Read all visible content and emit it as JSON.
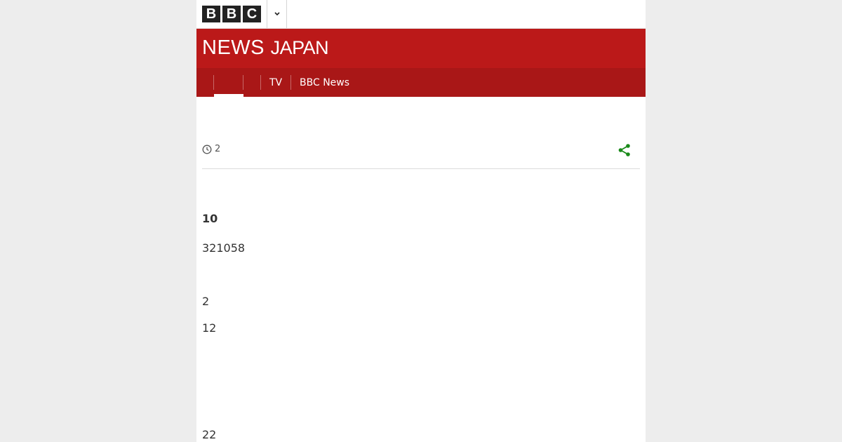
{
  "header": {
    "logo_letters": [
      "B",
      "B",
      "C"
    ],
    "menu_toggle_icon": "chevron-down-icon"
  },
  "brand": {
    "title_bold": "NEWS",
    "title_light": "JAPAN"
  },
  "nav": {
    "items": [
      {
        "label": ""
      },
      {
        "label": ""
      },
      {
        "label": "TV"
      },
      {
        "label": "BBC News"
      }
    ]
  },
  "article": {
    "meta": {
      "time": "2",
      "clock_icon": "clock-icon",
      "share_icon": "share-icon"
    },
    "paragraphs": [
      {
        "text": "10",
        "bold": true
      },
      {
        "text": "321058"
      },
      {
        "text": "2"
      },
      {
        "text": "12"
      },
      {
        "text": "22"
      }
    ]
  },
  "colors": {
    "brand_red": "#bb1919",
    "nav_red": "#a91717",
    "share_green": "#1a8a1a",
    "page_bg": "#ededed"
  }
}
